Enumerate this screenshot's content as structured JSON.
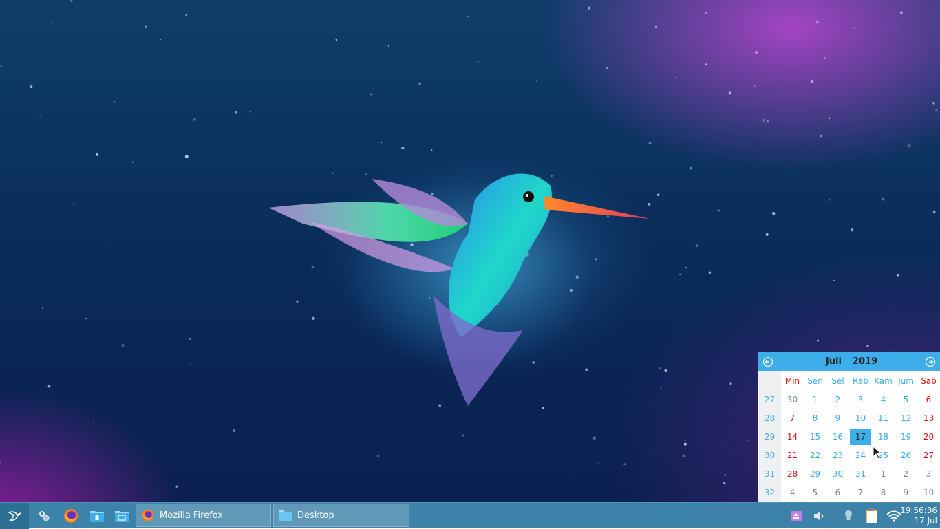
{
  "taskbar": {
    "launchers": [
      {
        "icon": "system-settings-icon"
      },
      {
        "icon": "firefox-icon"
      },
      {
        "icon": "home-folder-icon"
      },
      {
        "icon": "file-manager-icon"
      }
    ],
    "tasks": [
      {
        "label": "Mozilla Firefox",
        "icon": "firefox-icon"
      },
      {
        "label": "Desktop",
        "icon": "folder-icon"
      }
    ],
    "tray": [
      "removable-media-icon",
      "volume-icon",
      "lightbulb-icon",
      "clipboard-icon",
      "wifi-icon"
    ],
    "clock": {
      "time": "19:56:36",
      "date": "17 Jul"
    }
  },
  "calendar": {
    "month": "Juli",
    "year": "2019",
    "weekday_headers": [
      "Min",
      "Sen",
      "Sel",
      "Rab",
      "Kam",
      "Jum",
      "Sab"
    ],
    "weeks": [
      {
        "week": "27",
        "days": [
          "30",
          "1",
          "2",
          "3",
          "4",
          "5",
          "6"
        ]
      },
      {
        "week": "28",
        "days": [
          "7",
          "8",
          "9",
          "10",
          "11",
          "12",
          "13"
        ]
      },
      {
        "week": "29",
        "days": [
          "14",
          "15",
          "16",
          "17",
          "18",
          "19",
          "20"
        ]
      },
      {
        "week": "30",
        "days": [
          "21",
          "22",
          "23",
          "24",
          "25",
          "26",
          "27"
        ]
      },
      {
        "week": "31",
        "days": [
          "28",
          "29",
          "30",
          "31",
          "1",
          "2",
          "3"
        ]
      },
      {
        "week": "32",
        "days": [
          "4",
          "5",
          "6",
          "7",
          "8",
          "9",
          "10"
        ]
      }
    ],
    "today": "17",
    "colors": {
      "accent": "#3daee9",
      "weekend": "#da1111",
      "other_month": "#7f8c8d"
    }
  }
}
